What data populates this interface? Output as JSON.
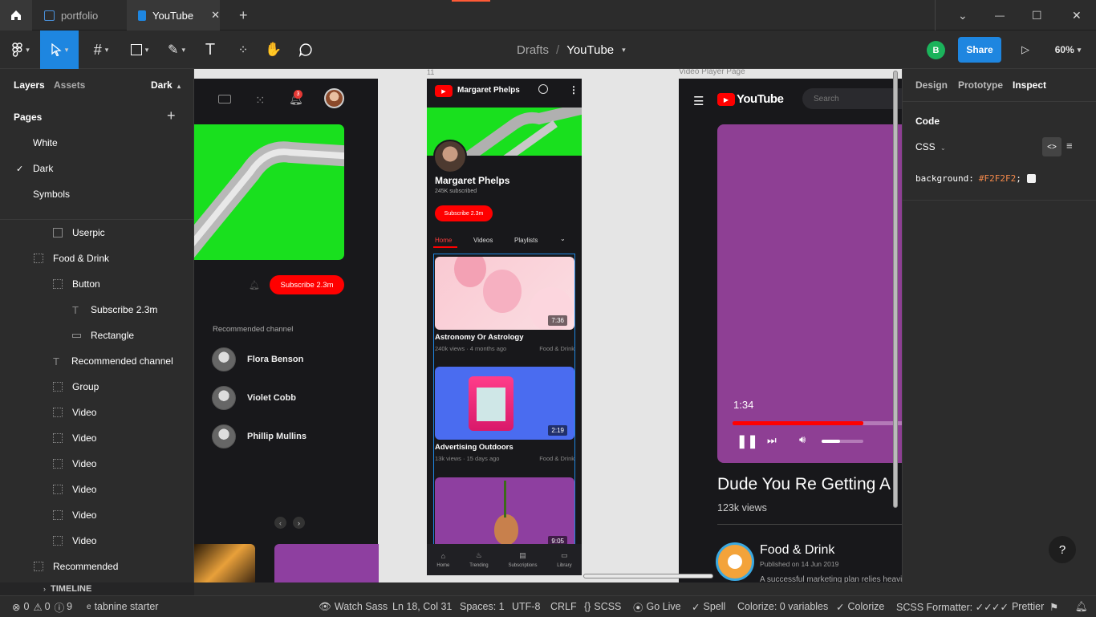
{
  "titlebar": {
    "tabs": [
      {
        "label": "portfolio"
      },
      {
        "label": "YouTube"
      }
    ],
    "new_tab": "+",
    "win_controls": {
      "dropdown": "⌄",
      "minimize": "—",
      "maximize": "☐",
      "close": "✕"
    }
  },
  "toolbar": {
    "breadcrumb_parent": "Drafts",
    "breadcrumb_sep": "/",
    "file_name": "YouTube",
    "user_initial": "B",
    "share_label": "Share",
    "zoom": "60%"
  },
  "left_panel": {
    "tabs": [
      "Layers",
      "Assets"
    ],
    "page_selector": "Dark",
    "pages_heading": "Pages",
    "pages": [
      "White",
      "Dark",
      "Symbols"
    ],
    "active_page": "Dark",
    "layers": [
      {
        "label": "Userpic",
        "icon": "image-icon"
      },
      {
        "label": "Food & Drink",
        "icon": "frame-icon"
      },
      {
        "label": "Button",
        "icon": "frame-icon"
      },
      {
        "label": "Subscribe 2.3m",
        "icon": "text-icon"
      },
      {
        "label": "Rectangle",
        "icon": "rectangle-icon"
      },
      {
        "label": "Recommended channel",
        "icon": "text-icon"
      },
      {
        "label": "Group",
        "icon": "frame-icon"
      },
      {
        "label": "Video",
        "icon": "frame-icon"
      },
      {
        "label": "Video",
        "icon": "frame-icon"
      },
      {
        "label": "Video",
        "icon": "frame-icon"
      },
      {
        "label": "Video",
        "icon": "frame-icon"
      },
      {
        "label": "Video",
        "icon": "frame-icon"
      },
      {
        "label": "Video",
        "icon": "frame-icon"
      },
      {
        "label": "Recommended",
        "icon": "frame-icon"
      }
    ],
    "timeline": "TIMELINE"
  },
  "canvas": {
    "frame_left": {
      "notification_count": "3",
      "subscribe_label": "Subscribe 2.3m",
      "recommended_heading": "Recommended channel",
      "channels": [
        "Flora Benson",
        "Violet Cobb",
        "Phillip Mullins"
      ]
    },
    "frame_mid": {
      "frame_label": "11",
      "channel_name": "Margaret Phelps",
      "subscribers": "245K subscribed",
      "subscribe_label": "Subscribe 2.3m",
      "tabs": [
        "Home",
        "Videos",
        "Playlists"
      ],
      "videos": [
        {
          "title": "Astronomy Or Astrology",
          "views": "240k views",
          "age": "4 months ago",
          "channel": "Food & Drink",
          "duration": "7:36"
        },
        {
          "title": "Advertising Outdoors",
          "views": "13k views",
          "age": "15 days ago",
          "channel": "Food & Drink",
          "duration": "2:19"
        },
        {
          "title": "",
          "views": "",
          "age": "",
          "channel": "",
          "duration": "9:05"
        }
      ],
      "nav": [
        "Home",
        "Trending",
        "Subscriptions",
        "Library"
      ]
    },
    "frame_right": {
      "frame_label": "Video Player Page",
      "logo_text": "YouTube",
      "search_placeholder": "Search",
      "time": "1:34",
      "progress": 0.74,
      "volume": 0.45,
      "video_title": "Dude You Re Getting A",
      "views": "123k views",
      "channel_name": "Food & Drink",
      "published": "Published on 14 Jun 2019",
      "description": "A successful marketing plan relies heavi"
    }
  },
  "right_panel": {
    "tabs": [
      "Design",
      "Prototype",
      "Inspect"
    ],
    "active_tab": "Inspect",
    "code_heading": "Code",
    "language": "CSS",
    "css_property": "background:",
    "css_value": "#F2F2F2",
    "css_end": ";",
    "help": "?"
  },
  "statusbar": {
    "errors": "0",
    "warnings": "0",
    "info": "9",
    "tabnine": "tabnine starter",
    "watch_sass": "Watch Sass",
    "position": "Ln 18, Col 31",
    "spaces": "Spaces: 1",
    "encoding": "UTF-8",
    "eol": "CRLF",
    "language": "SCSS",
    "go_live": "Go Live",
    "spell": "Spell",
    "colorize_vars": "Colorize: 0 variables",
    "colorize": "Colorize",
    "formatter": "SCSS Formatter: ✓✓",
    "prettier": "Prettier"
  },
  "colors": {
    "accent_blue": "#1e86e0",
    "youtube_red": "#ff0000",
    "green_thumb": "#19e01e",
    "purple_player": "#8e3f94"
  }
}
